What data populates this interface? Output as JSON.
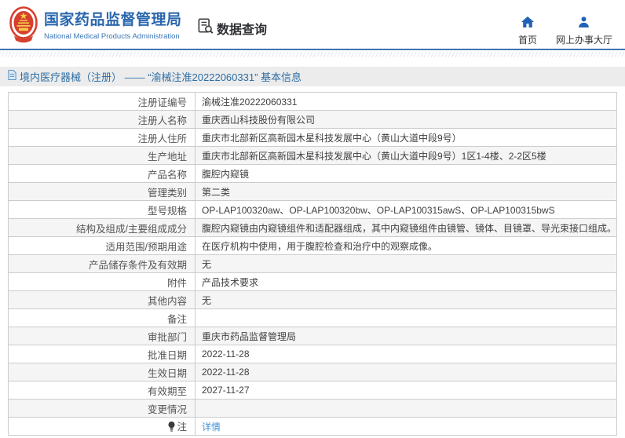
{
  "header": {
    "title": "国家药品监督管理局",
    "subtitle": "National Medical Products Administration",
    "data_query_label": "数据查询",
    "nav": [
      {
        "label": "首页",
        "icon": "home-icon"
      },
      {
        "label": "网上办事大厅",
        "icon": "user-icon"
      }
    ]
  },
  "breadcrumb": {
    "text": "境内医疗器械（注册） —— “渝械注准20222060331” 基本信息"
  },
  "table": {
    "rows": [
      {
        "label": "注册证编号",
        "value": "渝械注准20222060331"
      },
      {
        "label": "注册人名称",
        "value": "重庆西山科技股份有限公司"
      },
      {
        "label": "注册人住所",
        "value": "重庆市北部新区高新园木星科技发展中心（黄山大道中段9号）"
      },
      {
        "label": "生产地址",
        "value": "重庆市北部新区高新园木星科技发展中心（黄山大道中段9号）1区1-4楼、2-2区5楼"
      },
      {
        "label": "产品名称",
        "value": "腹腔内窥镜"
      },
      {
        "label": "管理类别",
        "value": "第二类"
      },
      {
        "label": "型号规格",
        "value": "OP-LAP100320aw、OP-LAP100320bw、OP-LAP100315awS、OP-LAP100315bwS"
      },
      {
        "label": "结构及组成/主要组成成分",
        "value": "腹腔内窥镜由内窥镜组件和适配器组成，其中内窥镜组件由镜管、镜体、目镜罩、导光束接口组成。"
      },
      {
        "label": "适用范围/预期用途",
        "value": "在医疗机构中使用，用于腹腔检查和治疗中的观察成像。"
      },
      {
        "label": "产品储存条件及有效期",
        "value": "无"
      },
      {
        "label": "附件",
        "value": "产品技术要求"
      },
      {
        "label": "其他内容",
        "value": "无"
      },
      {
        "label": "备注",
        "value": ""
      },
      {
        "label": "审批部门",
        "value": "重庆市药品监督管理局"
      },
      {
        "label": "批准日期",
        "value": "2022-11-28"
      },
      {
        "label": "生效日期",
        "value": "2022-11-28"
      },
      {
        "label": "有效期至",
        "value": "2027-11-27"
      },
      {
        "label": "变更情况",
        "value": ""
      },
      {
        "label": "注",
        "icon": "bulb",
        "value": "详情",
        "link": true
      }
    ]
  },
  "colors": {
    "brand_blue": "#2b67ad",
    "link_blue": "#4193d6",
    "emblem_red": "#d6402f",
    "emblem_gold": "#f7c948",
    "breadcrumb_bg": "#ececec",
    "alt_row_bg": "#f5f5f5"
  }
}
